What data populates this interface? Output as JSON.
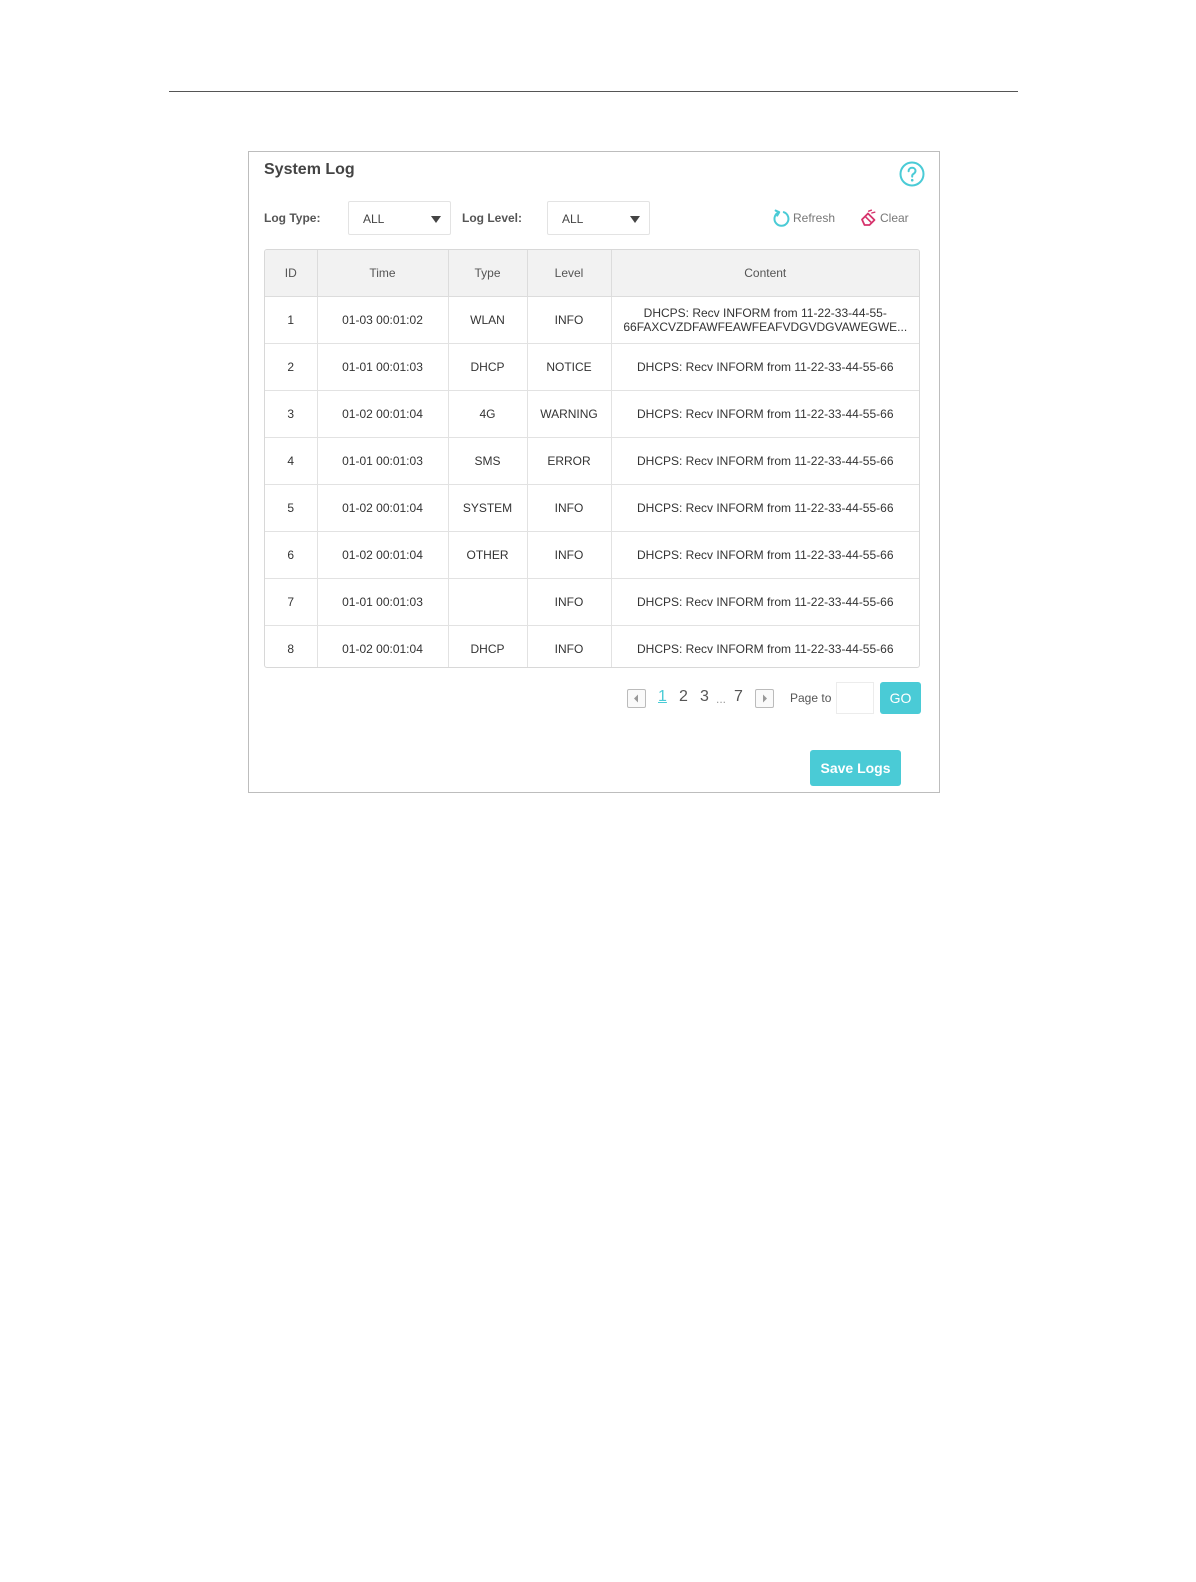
{
  "panel": {
    "title": "System Log"
  },
  "filters": {
    "log_type_label": "Log Type:",
    "log_type_value": "ALL",
    "log_level_label": "Log Level:",
    "log_level_value": "ALL"
  },
  "actions": {
    "refresh_label": "Refresh",
    "clear_label": "Clear"
  },
  "table": {
    "headers": {
      "id": "ID",
      "time": "Time",
      "type": "Type",
      "level": "Level",
      "content": "Content"
    },
    "rows": [
      {
        "id": "1",
        "time": "01-03 00:01:02",
        "type": "WLAN",
        "level": "INFO",
        "content_line1": "DHCPS: Recv INFORM from 11-22-33-44-55-",
        "content_line2": "66FAXCVZDFAWFEAWFEAFVDGVDGVAWEGWE..."
      },
      {
        "id": "2",
        "time": "01-01 00:01:03",
        "type": "DHCP",
        "level": "NOTICE",
        "content": "DHCPS: Recv INFORM from 11-22-33-44-55-66"
      },
      {
        "id": "3",
        "time": "01-02 00:01:04",
        "type": "4G",
        "level": "WARNING",
        "content": "DHCPS: Recv INFORM from 11-22-33-44-55-66"
      },
      {
        "id": "4",
        "time": "01-01 00:01:03",
        "type": "SMS",
        "level": "ERROR",
        "content": "DHCPS: Recv INFORM from 11-22-33-44-55-66"
      },
      {
        "id": "5",
        "time": "01-02 00:01:04",
        "type": "SYSTEM",
        "level": "INFO",
        "content": "DHCPS: Recv INFORM from 11-22-33-44-55-66"
      },
      {
        "id": "6",
        "time": "01-02 00:01:04",
        "type": "OTHER",
        "level": "INFO",
        "content": "DHCPS: Recv INFORM from 11-22-33-44-55-66"
      },
      {
        "id": "7",
        "time": "01-01 00:01:03",
        "type": "",
        "level": "INFO",
        "content": "DHCPS: Recv INFORM from 11-22-33-44-55-66"
      },
      {
        "id": "8",
        "time": "01-02 00:01:04",
        "type": "DHCP",
        "level": "INFO",
        "content": "DHCPS: Recv INFORM from 11-22-33-44-55-66"
      }
    ]
  },
  "pagination": {
    "pages": [
      "1",
      "2",
      "3"
    ],
    "ellipsis": "...",
    "last_page": "7",
    "current_page": "1",
    "page_to_label": "Page to",
    "page_input_value": "",
    "go_label": "GO"
  },
  "save_logs_label": "Save Logs",
  "colors": {
    "accent": "#4acbd6",
    "clear_icon": "#d6336c",
    "border": "#bdbdbd",
    "header_bg": "#f2f2f2"
  },
  "icons": {
    "help": "help-circle-icon",
    "refresh": "refresh-icon",
    "clear": "eraser-icon",
    "prev": "chevron-left-icon",
    "next": "chevron-right-icon",
    "dropdown": "caret-down-icon"
  }
}
